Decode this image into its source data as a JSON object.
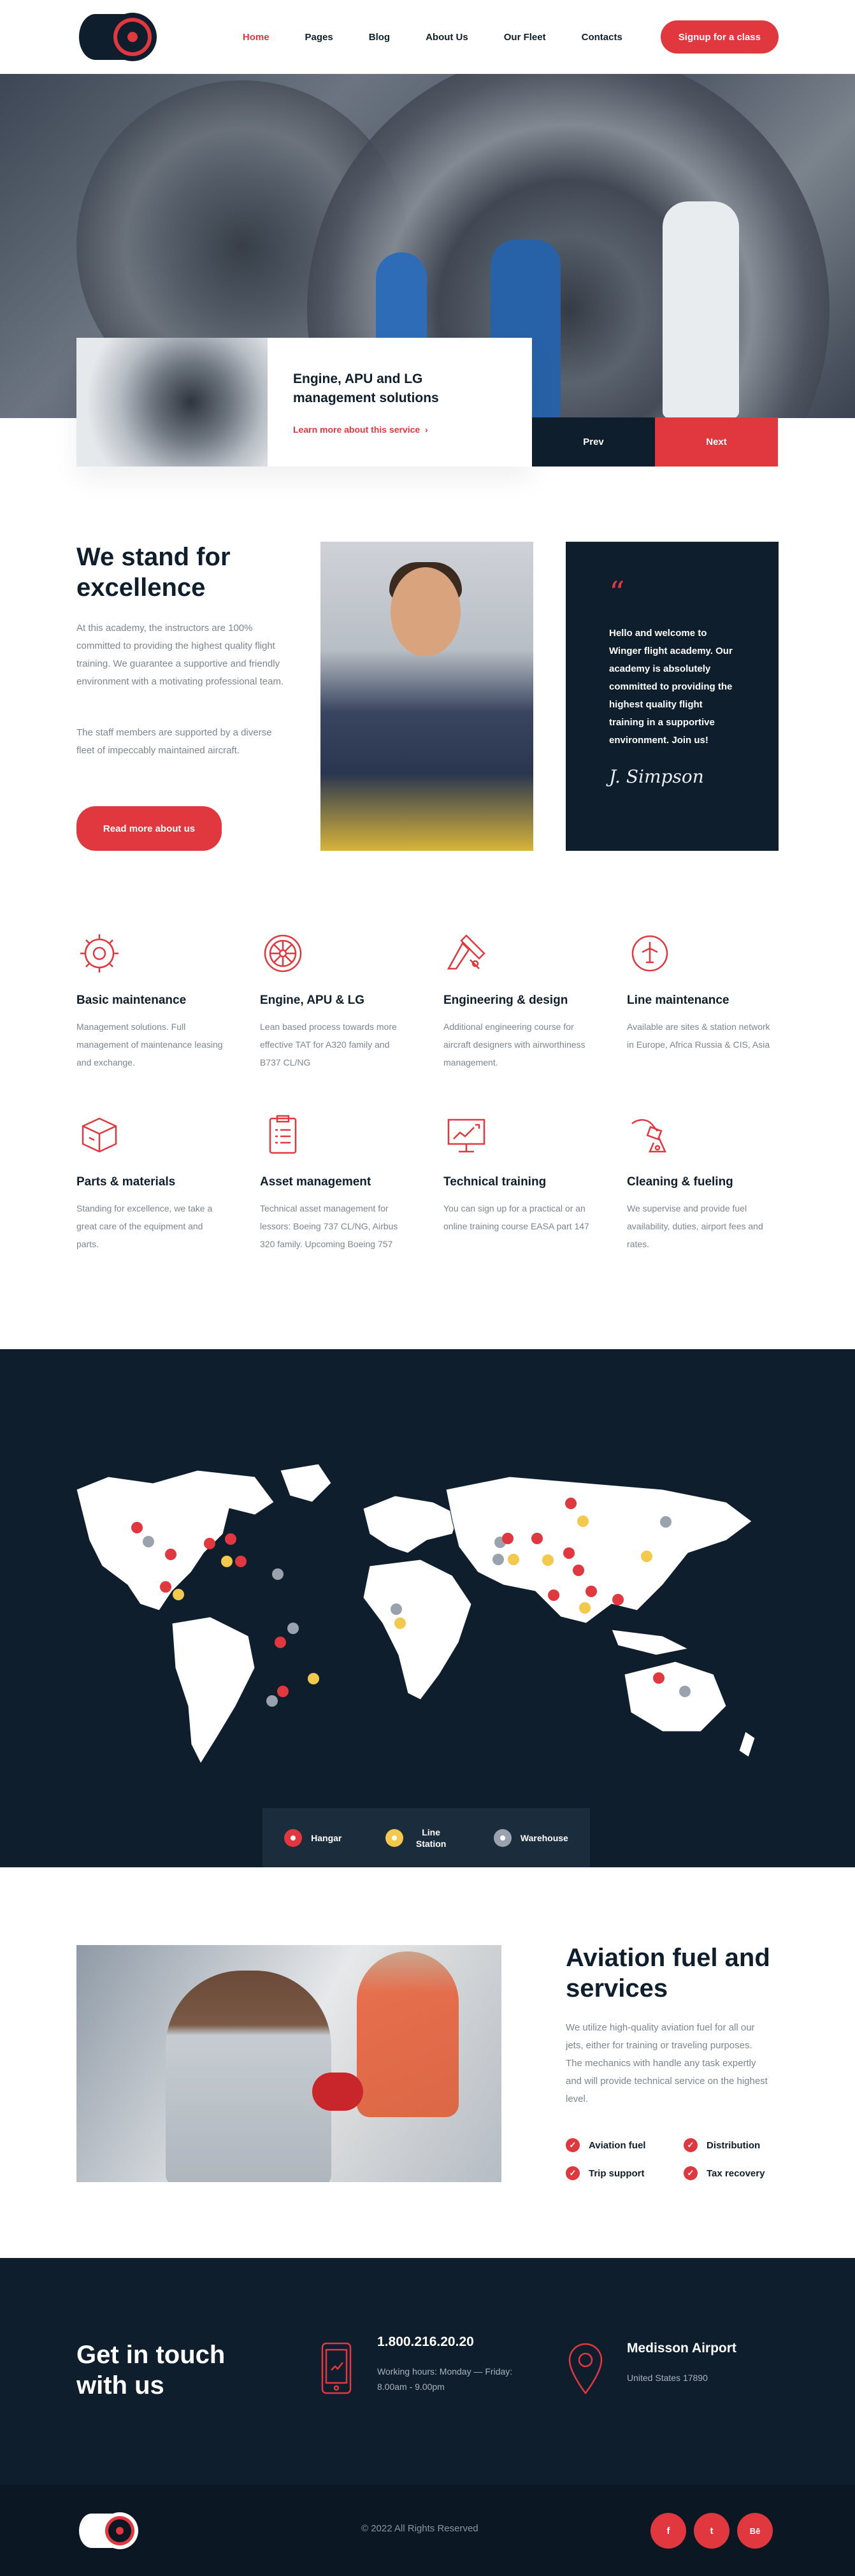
{
  "brand": {
    "accent": "#e0383e",
    "dark": "#0f1e2c"
  },
  "nav": {
    "items": [
      "Home",
      "Pages",
      "Blog",
      "About Us",
      "Our Fleet",
      "Contacts"
    ],
    "active": "Home",
    "signup_label": "Signup for a class"
  },
  "hero": {
    "card_title": "Engine, APU and LG management solutions",
    "card_link": "Learn more about this service",
    "prev_label": "Prev",
    "next_label": "Next"
  },
  "excellence": {
    "title": "We stand for excellence",
    "paragraph1": "At this academy, the instructors are 100% committed to providing the highest quality flight training. We guarantee a supportive and friendly environment with a motivating professional team.",
    "paragraph2": "The staff members are supported by a diverse fleet of impeccably maintained aircraft.",
    "button_label": "Read more about us",
    "quote_mark": "“",
    "quote": "Hello and welcome to Winger flight academy. Our academy is absolutely committed to providing the highest quality flight training in a supportive environment. Join us!",
    "signature": "J. Simpson"
  },
  "services": [
    {
      "icon": "gear-icon",
      "title": "Basic maintenance",
      "text": "Management solutions. Full management of maintenance leasing and exchange."
    },
    {
      "icon": "turbine-icon",
      "title": "Engine, APU & LG",
      "text": "Lean based process towards more effective TAT for A320 family and B737 CL/NG"
    },
    {
      "icon": "design-icon",
      "title": "Engineering & design",
      "text": "Additional engineering course for aircraft designers with airworthiness management."
    },
    {
      "icon": "plane-badge-icon",
      "title": "Line maintenance",
      "text": "Available are sites & station network in Europe, Africa Russia & CIS, Asia"
    },
    {
      "icon": "box-icon",
      "title": "Parts & materials",
      "text": "Standing for excellence, we take a great care of the equipment and parts."
    },
    {
      "icon": "clipboard-icon",
      "title": "Asset management",
      "text": "Technical asset management for lessors: Boeing 737 CL/NG, Airbus 320 family. Upcoming Boeing 757"
    },
    {
      "icon": "presentation-icon",
      "title": "Technical training",
      "text": "You can sign up for a practical or an online training course EASA part 147"
    },
    {
      "icon": "fuel-pump-icon",
      "title": "Cleaning & fueling",
      "text": "We supervise and provide fuel availability, duties, airport fees and rates."
    }
  ],
  "map": {
    "legend": [
      {
        "label": "Hangar",
        "color": "#e0383e"
      },
      {
        "label": "Line Station",
        "color": "#f2c94c"
      },
      {
        "label": "Warehouse",
        "color": "#9aa3ad"
      }
    ]
  },
  "fuel": {
    "title": "Aviation fuel and services",
    "text": "We utilize high-quality aviation fuel for all our jets, either for training or traveling purposes. The mechanics with handle any task expertly and will provide technical service on the highest level.",
    "checks": [
      "Aviation fuel",
      "Distribution",
      "Trip support",
      "Tax recovery"
    ]
  },
  "contact": {
    "title": "Get in touch with us",
    "phone": "1.800.216.20.20",
    "hours": "Working hours: Monday — Friday: 8.00am - 9.00pm",
    "airport": "Medisson Airport",
    "address": "United States 17890"
  },
  "footer": {
    "copyright": "© 2022 All Rights Reserved",
    "social": [
      "f",
      "t",
      "Bē"
    ]
  }
}
